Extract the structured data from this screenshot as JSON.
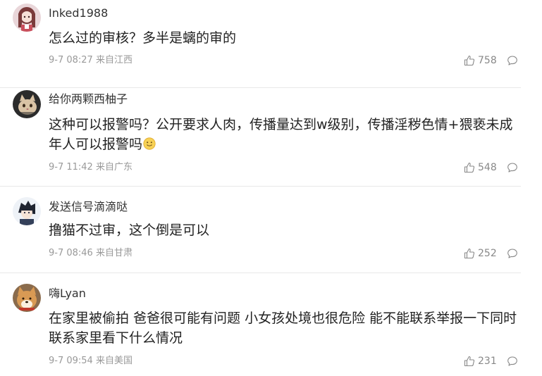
{
  "comments": [
    {
      "username": "Inked1988",
      "text": "怎么过的审核？多半是螭的审的",
      "emoji": "",
      "time": "9-7 08:27",
      "location": "来自江西",
      "likes": "758",
      "avatar_icon": "avatar-anime-girl-icon"
    },
    {
      "username": "给你两颗西柚子",
      "text": "这种可以报警吗？公开要求人肉，传播量达到w级别，传播淫秽色情+猥亵未成年人可以报警吗",
      "emoji": "smile-emoji-icon",
      "time": "9-7 11:42",
      "location": "来自广东",
      "likes": "548",
      "avatar_icon": "avatar-cat-icon"
    },
    {
      "username": "发送信号滴滴哒",
      "text": "撸猫不过审，这个倒是可以",
      "emoji": "",
      "time": "9-7 08:46",
      "location": "来自甘肃",
      "likes": "252",
      "avatar_icon": "avatar-anime-boy-icon"
    },
    {
      "username": "嗨Lyan",
      "text": "在家里被偷拍 爸爸很可能有问题 小女孩处境也很危险 能不能联系举报一下同时联系家里看下什么情况",
      "emoji": "",
      "time": "9-7 09:54",
      "location": "来自美国",
      "likes": "231",
      "avatar_icon": "avatar-shiba-dog-icon"
    }
  ],
  "colors": {
    "text": "#222222",
    "meta": "#999999",
    "divider": "#e8e8e8"
  }
}
